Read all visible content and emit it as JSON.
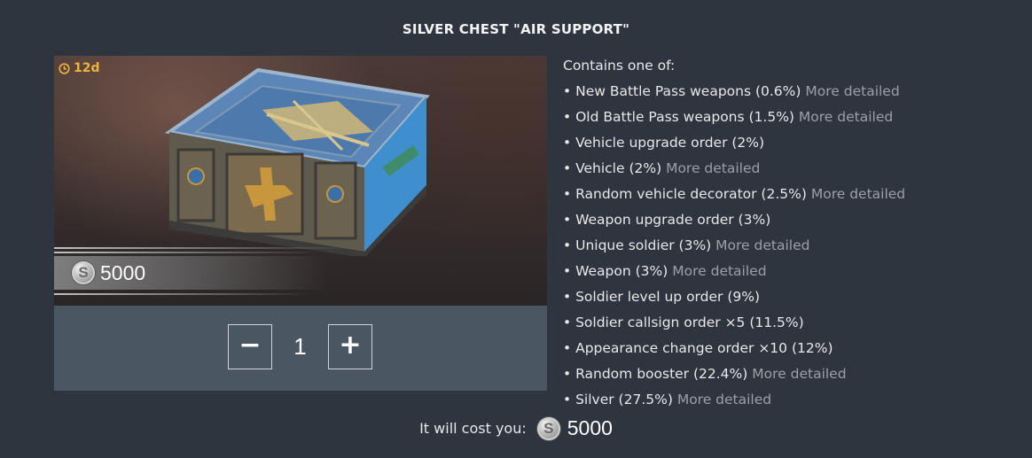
{
  "title": "SILVER CHEST \"AIR SUPPORT\"",
  "preview": {
    "timer": "12d",
    "price": "5000",
    "currency_icon": "silver-coin-icon",
    "coin_letter": "S"
  },
  "quantity": {
    "minus_label": "−",
    "value": "1",
    "plus_label": "+"
  },
  "contents": {
    "header": "Contains one of:",
    "bullet": "•",
    "more_label": "More detailed",
    "items": [
      {
        "label": "New Battle Pass weapons (0.6%)",
        "more": "More detailed"
      },
      {
        "label": "Old Battle Pass weapons (1.5%)",
        "more": "More detailed"
      },
      {
        "label": "Vehicle upgrade order (2%)",
        "more": ""
      },
      {
        "label": "Vehicle (2%)",
        "more": "More detailed"
      },
      {
        "label": "Random vehicle decorator (2.5%)",
        "more": "More detailed"
      },
      {
        "label": "Weapon upgrade order (3%)",
        "more": ""
      },
      {
        "label": "Unique soldier (3%)",
        "more": "More detailed"
      },
      {
        "label": "Weapon (3%)",
        "more": "More detailed"
      },
      {
        "label": "Soldier level up order (9%)",
        "more": ""
      },
      {
        "label": "Soldier callsign order ×5 (11.5%)",
        "more": ""
      },
      {
        "label": "Appearance change order ×10 (12%)",
        "more": ""
      },
      {
        "label": "Random booster (22.4%)",
        "more": "More detailed"
      },
      {
        "label": "Silver (27.5%)",
        "more": "More detailed"
      }
    ]
  },
  "total": {
    "label": "It will cost you:",
    "value": "5000"
  },
  "colors": {
    "background": "#2f353e",
    "timer": "#f0b43a",
    "more_link": "#9aa0a6",
    "qty_panel": "#4b5663"
  }
}
